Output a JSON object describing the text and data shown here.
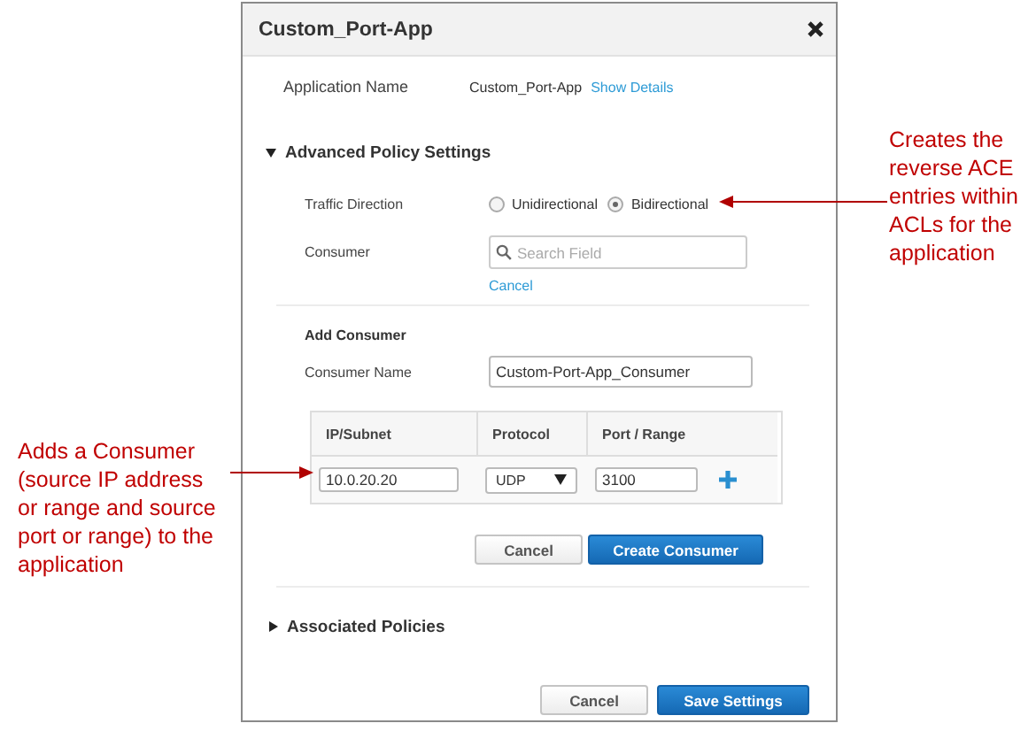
{
  "dialog": {
    "title": "Custom_Port-App"
  },
  "application": {
    "label": "Application Name",
    "value": "Custom_Port-App",
    "link": "Show Details"
  },
  "advanced": {
    "title": "Advanced Policy Settings",
    "expanded": true,
    "traffic": {
      "label": "Traffic Direction",
      "options": [
        {
          "label": "Unidirectional",
          "selected": false
        },
        {
          "label": "Bidirectional",
          "selected": true
        }
      ]
    },
    "consumer": {
      "label": "Consumer",
      "placeholder": "Search Field",
      "cancel": "Cancel"
    },
    "add_consumer": {
      "title": "Add Consumer",
      "name_label": "Consumer Name",
      "name_value": "Custom-Port-App_Consumer",
      "table": {
        "columns": [
          "IP/Subnet",
          "Protocol",
          "Port / Range"
        ],
        "row": {
          "ip": "10.0.20.20",
          "protocol": "UDP",
          "port": "3100"
        }
      },
      "buttons": [
        {
          "label": "Cancel",
          "kind": "secondary"
        },
        {
          "label": "Create Consumer",
          "kind": "primary"
        }
      ]
    }
  },
  "associated": {
    "title": "Associated Policies",
    "expanded": false
  },
  "footer_buttons": [
    {
      "label": "Cancel",
      "kind": "secondary"
    },
    {
      "label": "Save Settings",
      "kind": "primary"
    }
  ],
  "left_annotation": "Adds a Consumer (source IP address or range and source port or range) to the application",
  "right_annotation": "Creates the reverse ACE entries within ACLs for the application"
}
